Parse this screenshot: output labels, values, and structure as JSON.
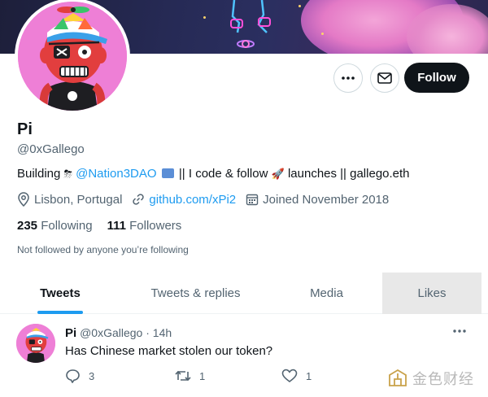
{
  "profile": {
    "name": "Pi",
    "handle": "@0xGallego",
    "bio": {
      "prefix": "Building",
      "mention": "@Nation3DAO",
      "middle": "|| I code & follow",
      "suffix": "launches || gallego.eth"
    },
    "location": "Lisbon, Portugal",
    "website": "github.com/xPi2",
    "joined": "Joined November 2018",
    "following_count": "235",
    "following_label": "Following",
    "followers_count": "111",
    "followers_label": "Followers",
    "not_followed_text": "Not followed by anyone you’re following"
  },
  "actions": {
    "more_icon": "more-horizontal-icon",
    "message_icon": "envelope-icon",
    "follow_label": "Follow"
  },
  "tabs": [
    {
      "label": "Tweets",
      "active": true
    },
    {
      "label": "Tweets & replies",
      "active": false
    },
    {
      "label": "Media",
      "active": false
    },
    {
      "label": "Likes",
      "active": false
    }
  ],
  "tweet": {
    "author": "Pi",
    "handle": "@0xGallego",
    "separator": "·",
    "time": "14h",
    "text": "Has Chinese market stolen our token?",
    "replies": "3",
    "retweets": "1",
    "likes": "1"
  },
  "watermark": {
    "text": "金色财经"
  },
  "colors": {
    "accent": "#1d9bf0",
    "text": "#0f1419",
    "secondary": "#536471",
    "follow_bg": "#0f1419",
    "avatar_bg": "#ee7fd6"
  }
}
